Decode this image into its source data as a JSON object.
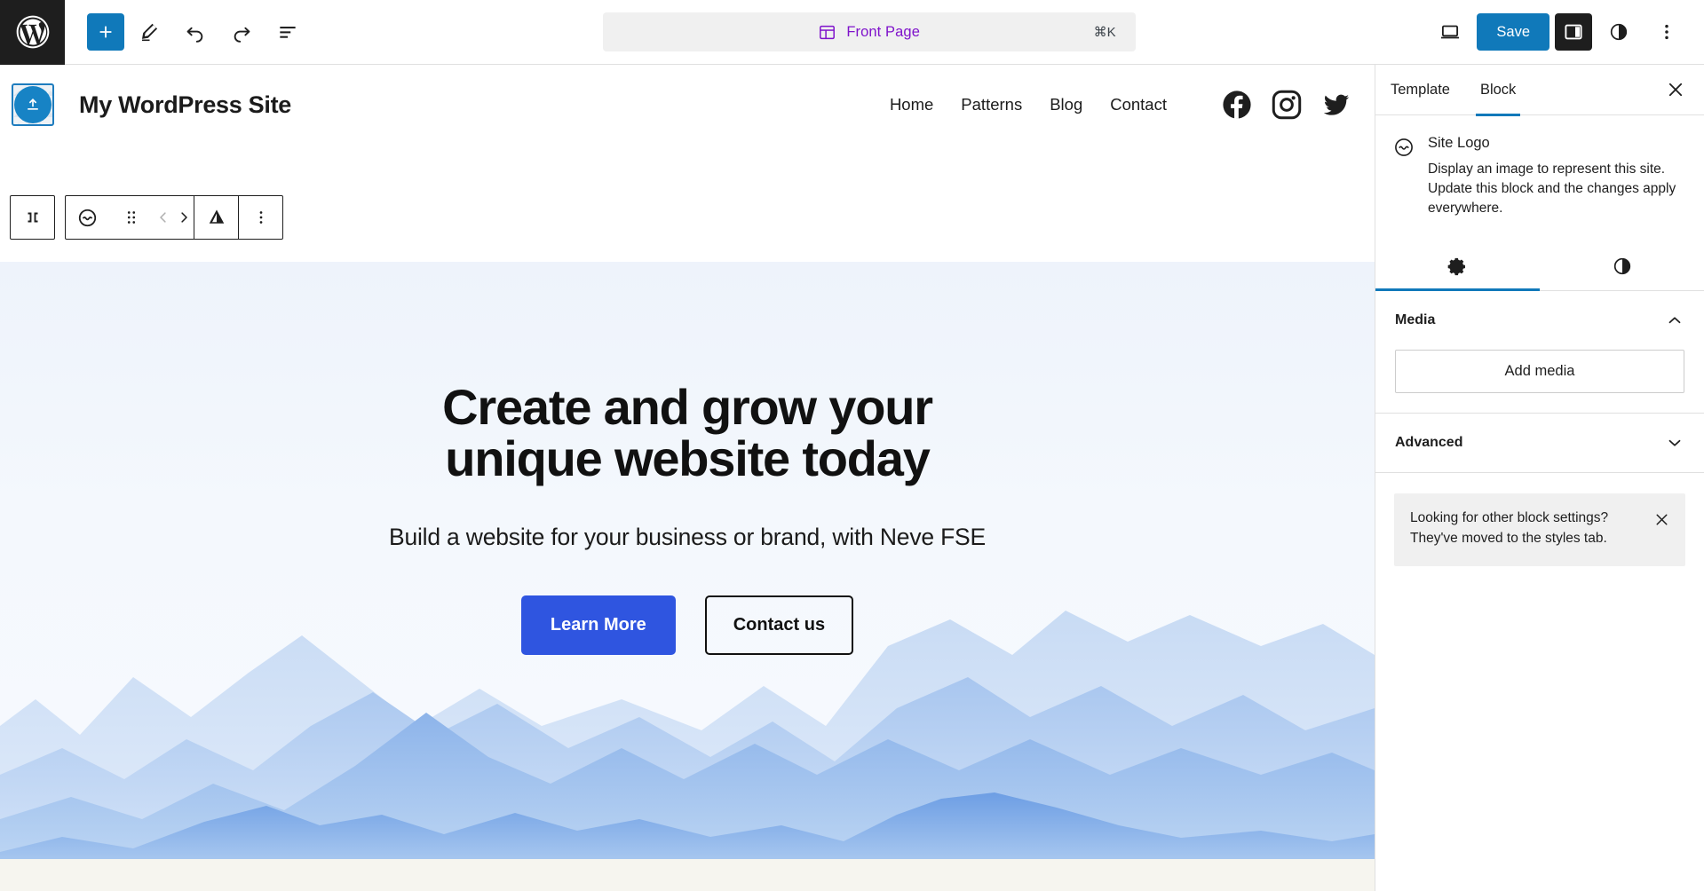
{
  "topbar": {
    "wp_logo": "wordpress-logo",
    "add_block_label": "+",
    "tools": [
      "add-block",
      "edit-pencil",
      "undo",
      "redo",
      "list-view"
    ],
    "document": {
      "title": "Front Page",
      "shortcut": "⌘K",
      "icon": "template-icon",
      "accent": "#7f13cb"
    },
    "device_preview": "desktop-icon",
    "save_label": "Save",
    "save_color": "#1079ba",
    "sidebar_toggle": "settings-sidebar-icon",
    "styles_icon": "styles-contrast-icon",
    "more_menu": "ellipsis-vertical-icon"
  },
  "site": {
    "logo_alt": "site-logo-placeholder",
    "title": "My WordPress Site",
    "nav": [
      {
        "label": "Home"
      },
      {
        "label": "Patterns"
      },
      {
        "label": "Blog"
      },
      {
        "label": "Contact"
      }
    ],
    "social": [
      {
        "name": "facebook-icon"
      },
      {
        "name": "instagram-icon"
      },
      {
        "name": "twitter-icon"
      }
    ]
  },
  "block_toolbar": {
    "select_parent": "select-parent-block-icon",
    "block_type": "site-logo-icon",
    "drag": "drag-handle-icon",
    "move_up": "‹",
    "move_down": "›",
    "align": "align-icon",
    "options": "more-options-icon"
  },
  "hero": {
    "title": "Create and grow your\nunique website today",
    "subtitle": "Build a website for your business or brand, with Neve FSE",
    "primary_button": "Learn More",
    "secondary_button": "Contact us",
    "primary_color": "#2f55e0",
    "background_gradient": "#eef3fb"
  },
  "sidebar": {
    "tabs": [
      {
        "label": "Template",
        "active": false
      },
      {
        "label": "Block",
        "active": true
      }
    ],
    "close_icon": "close-icon",
    "block": {
      "icon": "site-logo-icon",
      "name": "Site Logo",
      "description": "Display an image to represent this site. Update this block and the changes apply everywhere."
    },
    "subtabs": [
      {
        "name": "settings-gear-icon",
        "active": true
      },
      {
        "name": "styles-contrast-icon",
        "active": false
      }
    ],
    "sections": [
      {
        "title": "Media",
        "expanded": true,
        "chevron": "chevron-up-icon",
        "button": "Add media"
      },
      {
        "title": "Advanced",
        "expanded": false,
        "chevron": "chevron-down-icon"
      }
    ],
    "notice": {
      "text": "Looking for other block settings? They've moved to the styles tab.",
      "close_icon": "close-icon"
    }
  }
}
